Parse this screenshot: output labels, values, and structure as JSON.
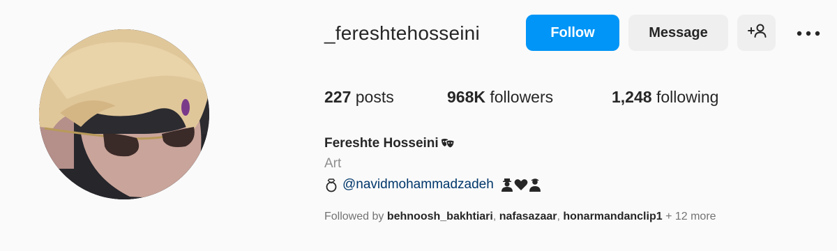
{
  "profile": {
    "username": "_fereshtehosseini",
    "full_name": "Fereshte Hosseini",
    "category": "Art",
    "bio_mention": "@navidmohammadzadeh",
    "avatar_icon": "profile-photo",
    "name_icon": "performing-arts-masks-icon",
    "bio_leading_icon": "ring-icon",
    "bio_trailing_icons": [
      "bust-silhouette-icon",
      "black-heart-icon",
      "bust-silhouette-icon"
    ]
  },
  "actions": {
    "follow_label": "Follow",
    "message_label": "Message",
    "suggest_icon": "add-person-icon",
    "more_icon": "more-options-icon"
  },
  "stats": {
    "posts_count": "227",
    "posts_label": "posts",
    "followers_count": "968K",
    "followers_label": "followers",
    "following_count": "1,248",
    "following_label": "following"
  },
  "followed_by": {
    "prefix": "Followed by",
    "accounts": [
      "behnoosh_bakhtiari",
      "nafasazaar",
      "honarmandanclip1"
    ],
    "more_label": "+ 12 more"
  },
  "colors": {
    "background": "#fafafa",
    "follow_button": "#0095f6",
    "secondary_button": "#efefef",
    "link": "#00376b",
    "muted": "#8e8e8e"
  }
}
